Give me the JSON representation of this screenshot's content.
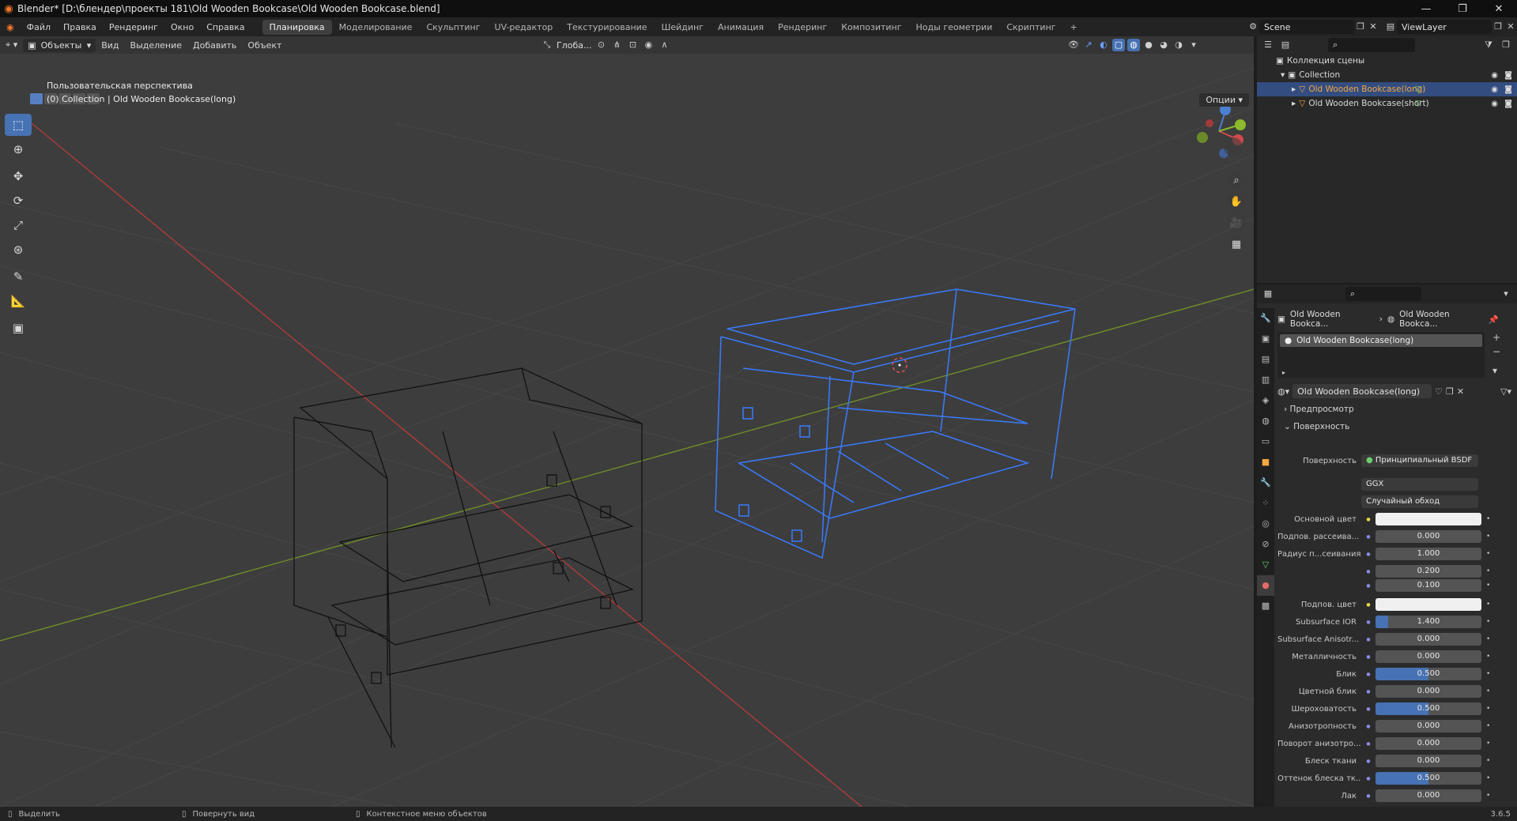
{
  "window": {
    "title": "Blender* [D:\\блендер\\проекты 181\\Old Wooden Bookcase\\Old Wooden Bookcase.blend]",
    "minimize": "—",
    "maximize": "❐",
    "close": "✕"
  },
  "menu": [
    "Файл",
    "Правка",
    "Рендеринг",
    "Окно",
    "Справка"
  ],
  "workspaces": [
    "Планировка",
    "Моделирование",
    "Скульптинг",
    "UV-редактор",
    "Текстурирование",
    "Шейдинг",
    "Анимация",
    "Рендеринг",
    "Композитинг",
    "Ноды геометрии",
    "Скриптинг"
  ],
  "active_workspace": "Планировка",
  "add_workspace": "+",
  "scene": {
    "name": "Scene",
    "view_layer": "ViewLayer"
  },
  "viewport": {
    "mode": "Объекты",
    "menus": [
      "Вид",
      "Выделение",
      "Добавить",
      "Объект"
    ],
    "transform_orientation": "Глоба...",
    "options": "Опции",
    "info_line1": "Пользовательская перспектива",
    "info_line2": "(0) Collection | Old Wooden Bookcase(long)"
  },
  "tools": [
    "select-box",
    "cursor",
    "move",
    "rotate",
    "scale",
    "transform",
    "annotate",
    "measure",
    "add-cube"
  ],
  "outliner": {
    "root": "Коллекция сцены",
    "collection": "Collection",
    "items": [
      {
        "name": "Old Wooden Bookcase(long)",
        "selected": true
      },
      {
        "name": "Old Wooden Bookcase(short)",
        "selected": false
      }
    ]
  },
  "properties": {
    "breadcrumb": [
      "Old Wooden Bookca...",
      "Old Wooden Bookca..."
    ],
    "material_slot": "Old Wooden Bookcase(long)",
    "material_name": "Old Wooden Bookcase(long)",
    "sections": {
      "preview": "Предпросмотр",
      "surface": "Поверхность"
    },
    "surface_label": "Поверхность",
    "surface_value": "Принципиальный BSDF",
    "distribution": "GGX",
    "subsurface_method": "Случайный обход",
    "rows": [
      {
        "label": "Основной цвет",
        "value": "",
        "type": "color"
      },
      {
        "label": "Подпов. рассеива...",
        "value": "0.000",
        "fill": 0
      },
      {
        "label": "Радиус п...сеивания",
        "value": "1.000",
        "fill": 0
      },
      {
        "label": "",
        "value": "0.200",
        "fill": 0
      },
      {
        "label": "",
        "value": "0.100",
        "fill": 0
      },
      {
        "label": "Подпов. цвет",
        "value": "",
        "type": "color"
      },
      {
        "label": "Subsurface IOR",
        "value": "1.400",
        "fill": 0.12
      },
      {
        "label": "Subsurface Anisotr...",
        "value": "0.000",
        "fill": 0
      },
      {
        "label": "Металличность",
        "value": "0.000",
        "fill": 0
      },
      {
        "label": "Блик",
        "value": "0.500",
        "fill": 0.5
      },
      {
        "label": "Цветной блик",
        "value": "0.000",
        "fill": 0
      },
      {
        "label": "Шероховатость",
        "value": "0.500",
        "fill": 0.5
      },
      {
        "label": "Анизотропность",
        "value": "0.000",
        "fill": 0
      },
      {
        "label": "Поворот анизотро...",
        "value": "0.000",
        "fill": 0
      },
      {
        "label": "Блеск ткани",
        "value": "0.000",
        "fill": 0
      },
      {
        "label": "Оттенок блеска тк...",
        "value": "0.500",
        "fill": 0.5
      },
      {
        "label": "Лак",
        "value": "0.000",
        "fill": 0
      }
    ]
  },
  "status": {
    "left": "Выделить",
    "middle": "Повернуть вид",
    "right": "Контекстное меню объектов",
    "version": "3.6.5"
  },
  "colors": {
    "accent": "#4772b3",
    "selected_wire": "#3a7bff",
    "x_axis": "#c23b3b",
    "y_axis": "#7a9a2a"
  }
}
